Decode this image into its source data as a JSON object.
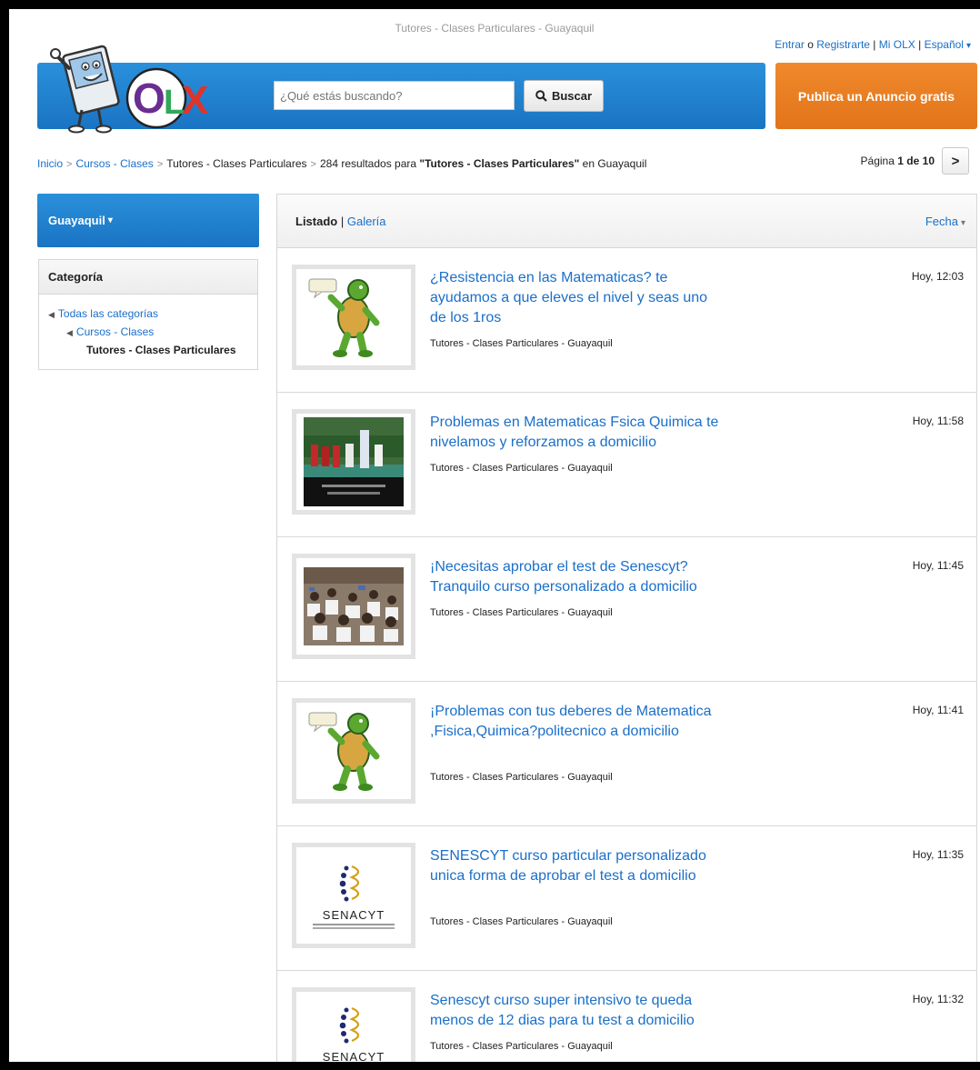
{
  "window": {
    "title": "Tutores - Clases Particulares - Guayaquil"
  },
  "top_links": {
    "login": "Entrar",
    "or": "o",
    "register": "Registrarte",
    "sep1": "|",
    "my_olx": "Mi OLX",
    "sep2": "|",
    "language": "Español"
  },
  "header": {
    "logo_text": "OLX",
    "search_placeholder": "¿Qué estás buscando?",
    "search_button": "Buscar",
    "publish_button": "Publica un Anuncio gratis",
    "brand_colors": {
      "blue": "#1a74c3",
      "orange": "#e2741a",
      "link": "#1a6fc9"
    }
  },
  "breadcrumb": {
    "home": "Inicio",
    "level1": "Cursos - Clases",
    "level2": "Tutores - Clases Particulares",
    "results_prefix": "284 resultados para",
    "results_query": "\"Tutores - Clases Particulares\"",
    "results_suffix": "en Guayaquil"
  },
  "pager": {
    "label": "Página",
    "current": "1",
    "of": "de",
    "total": "10",
    "next_icon": "chevron-right-icon"
  },
  "sidebar": {
    "city": "Guayaquil",
    "category_title": "Categoría",
    "categories": [
      "Todas las categorías",
      "Cursos - Clases",
      "Tutores - Clases Particulares"
    ]
  },
  "results": {
    "view_list": "Listado",
    "view_sep": "|",
    "view_gallery": "Galería",
    "sort_label": "Fecha",
    "listings": [
      {
        "title": "¿Resistencia en las Matematicas? te ayudamos a que eleves el nivel y seas uno de los 1ros",
        "category": "Tutores - Clases Particulares - Guayaquil",
        "date": "Hoy, 12:03",
        "thumb": "turtle"
      },
      {
        "title": "Problemas en Matematicas Fsica Quimica te nivelamos y reforzamos a domicilio",
        "category": "Tutores - Clases Particulares - Guayaquil",
        "date": "Hoy, 11:58",
        "thumb": "photo-group"
      },
      {
        "title": "¡Necesitas aprobar el test de Senescyt? Tranquilo curso personalizado a domicilio",
        "category": "Tutores - Clases Particulares - Guayaquil",
        "date": "Hoy, 11:45",
        "thumb": "photo-classroom"
      },
      {
        "title": "¡Problemas con tus deberes de Matematica ,Fisica,Quimica?politecnico a domicilio",
        "category": "Tutores - Clases Particulares - Guayaquil",
        "date": "Hoy, 11:41",
        "thumb": "turtle"
      },
      {
        "title": "SENESCYT curso particular personalizado unica forma de aprobar el test a domicilio",
        "category": "Tutores - Clases Particulares - Guayaquil",
        "date": "Hoy, 11:35",
        "thumb": "senacyt",
        "thumb_text": "SENACYT"
      },
      {
        "title": "Senescyt curso super intensivo te queda menos de 12 dias para tu test a domicilio",
        "category": "Tutores - Clases Particulares - Guayaquil",
        "date": "Hoy, 11:32",
        "thumb": "senacyt",
        "thumb_text": "SENACYT"
      }
    ]
  }
}
